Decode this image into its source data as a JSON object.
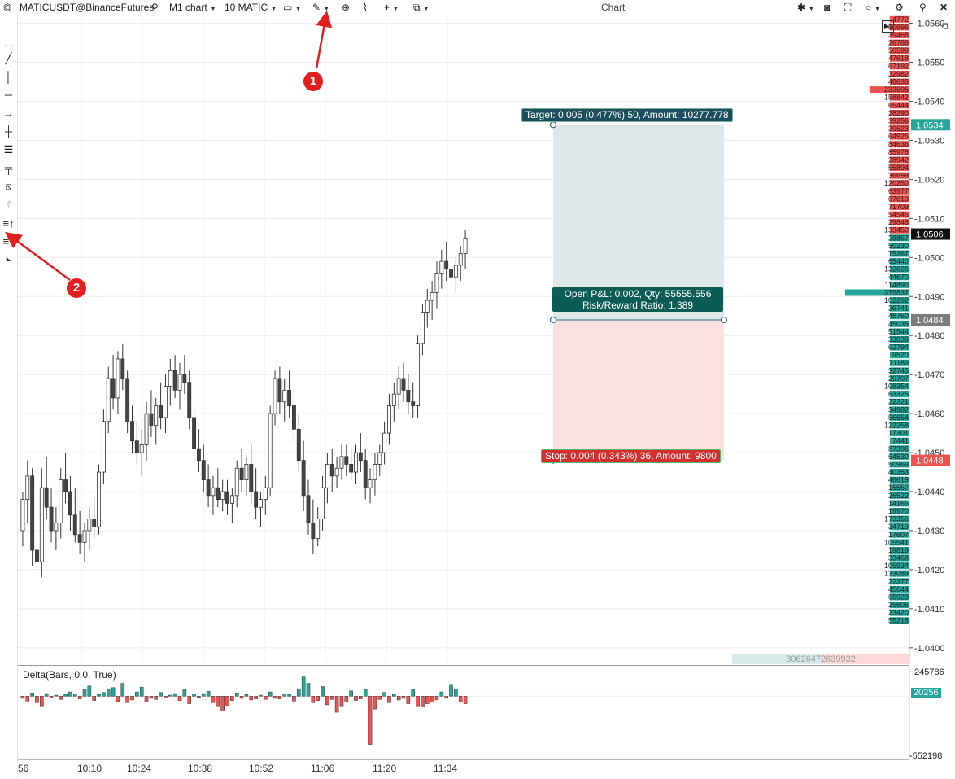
{
  "toolbar": {
    "symbol": "MATICUSDT@BinanceFutures",
    "timeframe": "M1 chart",
    "volume": "10 MATIC",
    "title": "Chart"
  },
  "colors": {
    "bull": "#26a69a",
    "bear": "#ef5350",
    "target_fill": "#dde9e8",
    "stop_fill": "#fbe0e0",
    "target_label": "#1b4f5e",
    "open_label": "#0a5c55",
    "stop_label": "#d32f2f",
    "marker": "#e31e1e"
  },
  "annotations": {
    "marker1": "1",
    "marker2": "2"
  },
  "position_tool": {
    "target_text": "Target: 0.005 (0.477%) 50, Amount: 10277.778",
    "open_text_1": "Open P&L: 0.002, Qty: 55555.556",
    "open_text_2": "Risk/Reward Ratio: 1.389",
    "stop_text": "Stop: 0.004 (0.343%) 36, Amount: 9800",
    "target_price": 1.0534,
    "entry_price": 1.0484,
    "stop_price": 1.0448
  },
  "price_axis": {
    "ticks": [
      "1.0560",
      "1.0550",
      "1.0540",
      "1.0530",
      "1.0520",
      "1.0510",
      "1.0500",
      "1.0490",
      "1.0480",
      "1.0470",
      "1.0460",
      "1.0450",
      "1.0440",
      "1.0430",
      "1.0420",
      "1.0410",
      "1.0400"
    ],
    "current_price": "1.0506",
    "target_label": "1.0534",
    "entry_label": "1.0484",
    "stop_label": "1.0448"
  },
  "time_axis": {
    "labels": [
      "56",
      "10:10",
      "10:24",
      "10:38",
      "10:52",
      "11:06",
      "11:20",
      "11:34"
    ]
  },
  "dom_volumes": [
    "4772",
    "50696",
    "39468",
    "26789",
    "50599",
    "47618",
    "67192",
    "32982",
    "48638",
    "233595",
    "158842",
    "65444",
    "28290",
    "39256",
    "39623",
    "64925",
    "84636",
    "85976",
    "28942",
    "55894",
    "36699",
    "120250",
    "63977",
    "67619",
    "71709",
    "54545",
    "29848",
    "133450",
    "28857",
    "50230",
    "75267",
    "65440",
    "132626",
    "44670",
    "114890",
    "375837",
    "102292",
    "26741",
    "48760",
    "45035",
    "51544",
    "33839",
    "62794",
    "9520",
    "71189",
    "32745",
    "29707",
    "108354",
    "63325",
    "22321",
    "34982",
    "56654",
    "122258",
    "17301",
    "7441",
    "87396",
    "64530",
    "50969",
    "40353",
    "46619",
    "15557",
    "26522",
    "14165",
    "19970",
    "173356",
    "34719",
    "17607",
    "105541",
    "19819",
    "33468",
    "105934",
    "133089",
    "22377",
    "45644",
    "65923",
    "25606",
    "23420",
    "55218"
  ],
  "dom_summary": "30626472639932",
  "indicator": {
    "name": "Delta(Bars, 0.0, True)",
    "top": "245786",
    "current": "20256",
    "bottom": "-552198"
  },
  "chart_data": [
    {
      "type": "candlestick",
      "title": "MATICUSDT@BinanceFutures",
      "x_range": [
        "09:56",
        "11:35"
      ],
      "ylim": [
        1.0396,
        1.0562
      ],
      "grid": true,
      "candles": [
        [
          1.043,
          1.044,
          1.0426,
          1.0438
        ],
        [
          1.0438,
          1.0448,
          1.0432,
          1.0444
        ],
        [
          1.0444,
          1.0446,
          1.0421,
          1.0425
        ],
        [
          1.0425,
          1.0432,
          1.0419,
          1.0422
        ],
        [
          1.0422,
          1.0446,
          1.0418,
          1.0441
        ],
        [
          1.0441,
          1.0449,
          1.0433,
          1.0436
        ],
        [
          1.0436,
          1.0441,
          1.0427,
          1.043
        ],
        [
          1.043,
          1.0436,
          1.0425,
          1.0432
        ],
        [
          1.0432,
          1.0446,
          1.0428,
          1.0443
        ],
        [
          1.0443,
          1.045,
          1.0437,
          1.044
        ],
        [
          1.044,
          1.0444,
          1.043,
          1.0434
        ],
        [
          1.0434,
          1.0441,
          1.0427,
          1.0429
        ],
        [
          1.0429,
          1.0435,
          1.0424,
          1.0427
        ],
        [
          1.0427,
          1.0432,
          1.0422,
          1.043
        ],
        [
          1.043,
          1.0436,
          1.0425,
          1.0433
        ],
        [
          1.0433,
          1.0439,
          1.0428,
          1.0431
        ],
        [
          1.0431,
          1.0447,
          1.0429,
          1.0445
        ],
        [
          1.0445,
          1.0461,
          1.0442,
          1.0458
        ],
        [
          1.0458,
          1.0472,
          1.0455,
          1.0469
        ],
        [
          1.0469,
          1.0475,
          1.0461,
          1.0464
        ],
        [
          1.0464,
          1.0476,
          1.046,
          1.0474
        ],
        [
          1.0474,
          1.0478,
          1.0466,
          1.0469
        ],
        [
          1.0469,
          1.0471,
          1.0455,
          1.0458
        ],
        [
          1.0458,
          1.0462,
          1.045,
          1.0453
        ],
        [
          1.0453,
          1.0458,
          1.0447,
          1.045
        ],
        [
          1.045,
          1.0456,
          1.0444,
          1.0452
        ],
        [
          1.0452,
          1.0463,
          1.0448,
          1.046
        ],
        [
          1.046,
          1.0466,
          1.0454,
          1.0457
        ],
        [
          1.0457,
          1.0464,
          1.0452,
          1.0462
        ],
        [
          1.0462,
          1.0468,
          1.0456,
          1.0459
        ],
        [
          1.0459,
          1.047,
          1.0455,
          1.0467
        ],
        [
          1.0467,
          1.0474,
          1.0462,
          1.0471
        ],
        [
          1.0471,
          1.0475,
          1.0464,
          1.0466
        ],
        [
          1.0466,
          1.0473,
          1.0461,
          1.047
        ],
        [
          1.047,
          1.0475,
          1.0465,
          1.0468
        ],
        [
          1.0468,
          1.0471,
          1.0456,
          1.0459
        ],
        [
          1.0459,
          1.0462,
          1.0448,
          1.0451
        ],
        [
          1.0451,
          1.0456,
          1.0445,
          1.0448
        ],
        [
          1.0448,
          1.0452,
          1.044,
          1.0443
        ],
        [
          1.0443,
          1.0447,
          1.0436,
          1.0439
        ],
        [
          1.0439,
          1.0444,
          1.0434,
          1.0441
        ],
        [
          1.0441,
          1.0446,
          1.0436,
          1.0438
        ],
        [
          1.0438,
          1.0443,
          1.0435,
          1.044
        ],
        [
          1.044,
          1.0443,
          1.0434,
          1.0437
        ],
        [
          1.0437,
          1.0441,
          1.0432,
          1.0439
        ],
        [
          1.0439,
          1.0448,
          1.0436,
          1.0446
        ],
        [
          1.0446,
          1.0451,
          1.044,
          1.0443
        ],
        [
          1.0443,
          1.0449,
          1.0439,
          1.0447
        ],
        [
          1.0447,
          1.0452,
          1.0437,
          1.044
        ],
        [
          1.044,
          1.0446,
          1.0433,
          1.0436
        ],
        [
          1.0436,
          1.044,
          1.0431,
          1.0438
        ],
        [
          1.0438,
          1.0444,
          1.0434,
          1.0441
        ],
        [
          1.0441,
          1.0462,
          1.0439,
          1.046
        ],
        [
          1.046,
          1.0471,
          1.0457,
          1.0469
        ],
        [
          1.0469,
          1.0472,
          1.046,
          1.0463
        ],
        [
          1.0463,
          1.0469,
          1.0458,
          1.0466
        ],
        [
          1.0466,
          1.0471,
          1.0459,
          1.0462
        ],
        [
          1.0462,
          1.0466,
          1.0452,
          1.0456
        ],
        [
          1.0456,
          1.046,
          1.0445,
          1.0448
        ],
        [
          1.0448,
          1.0453,
          1.0435,
          1.0439
        ],
        [
          1.0439,
          1.0443,
          1.0429,
          1.0432
        ],
        [
          1.0432,
          1.0438,
          1.0424,
          1.0428
        ],
        [
          1.0428,
          1.0436,
          1.0426,
          1.0433
        ],
        [
          1.0433,
          1.0444,
          1.043,
          1.0441
        ],
        [
          1.0441,
          1.045,
          1.0437,
          1.0447
        ],
        [
          1.0447,
          1.0451,
          1.044,
          1.0444
        ],
        [
          1.0444,
          1.0449,
          1.0441,
          1.0446
        ],
        [
          1.0446,
          1.0452,
          1.0443,
          1.0449
        ],
        [
          1.0449,
          1.0452,
          1.0444,
          1.0447
        ],
        [
          1.0447,
          1.0451,
          1.0443,
          1.0445
        ],
        [
          1.0445,
          1.0452,
          1.0442,
          1.045
        ],
        [
          1.045,
          1.0455,
          1.0445,
          1.0448
        ],
        [
          1.0448,
          1.0451,
          1.0438,
          1.0441
        ],
        [
          1.0441,
          1.0446,
          1.0437,
          1.0443
        ],
        [
          1.0443,
          1.045,
          1.0439,
          1.0447
        ],
        [
          1.0447,
          1.0452,
          1.0444,
          1.045
        ],
        [
          1.045,
          1.0458,
          1.0447,
          1.0455
        ],
        [
          1.0455,
          1.0465,
          1.0452,
          1.0462
        ],
        [
          1.0462,
          1.0468,
          1.0458,
          1.0465
        ],
        [
          1.0465,
          1.0472,
          1.0461,
          1.0469
        ],
        [
          1.0469,
          1.0473,
          1.0463,
          1.0466
        ],
        [
          1.0466,
          1.047,
          1.046,
          1.0463
        ],
        [
          1.0463,
          1.0468,
          1.0459,
          1.0462
        ],
        [
          1.0462,
          1.048,
          1.0459,
          1.0478
        ],
        [
          1.0478,
          1.0488,
          1.0475,
          1.0486
        ],
        [
          1.0486,
          1.0492,
          1.0482,
          1.0489
        ],
        [
          1.0489,
          1.0494,
          1.0484,
          1.0491
        ],
        [
          1.0491,
          1.0499,
          1.0487,
          1.0496
        ],
        [
          1.0496,
          1.0502,
          1.0492,
          1.0499
        ],
        [
          1.0499,
          1.0504,
          1.0494,
          1.0497
        ],
        [
          1.0497,
          1.0501,
          1.0492,
          1.0495
        ],
        [
          1.0495,
          1.05,
          1.0491,
          1.0498
        ],
        [
          1.0498,
          1.0503,
          1.0494,
          1.0501
        ],
        [
          1.0501,
          1.0507,
          1.0497,
          1.0505
        ]
      ]
    },
    {
      "type": "bar",
      "title": "Delta(Bars, 0.0, True)",
      "ylim": [
        -552198,
        245786
      ],
      "values": [
        -20000,
        -45000,
        30000,
        -60000,
        -90000,
        25000,
        -15000,
        10000,
        -30000,
        18000,
        40000,
        20000,
        -25000,
        60000,
        95000,
        -40000,
        15000,
        35000,
        70000,
        80000,
        -50000,
        120000,
        -60000,
        -35000,
        40000,
        85000,
        -55000,
        -20000,
        -30000,
        35000,
        -15000,
        10000,
        25000,
        -40000,
        60000,
        -70000,
        20000,
        -10000,
        25000,
        45000,
        -60000,
        -90000,
        -140000,
        -85000,
        -40000,
        30000,
        -20000,
        15000,
        -35000,
        -25000,
        10000,
        -30000,
        40000,
        -20000,
        -25000,
        20000,
        15000,
        -45000,
        70000,
        180000,
        120000,
        -60000,
        -40000,
        90000,
        -80000,
        -30000,
        -150000,
        -90000,
        -55000,
        50000,
        -40000,
        -25000,
        60000,
        -450000,
        -120000,
        -30000,
        35000,
        -60000,
        20000,
        -35000,
        -20000,
        -70000,
        60000,
        -90000,
        -100000,
        -70000,
        -55000,
        -35000,
        40000,
        -20000,
        110000,
        70000,
        -55000,
        -70000
      ]
    }
  ]
}
